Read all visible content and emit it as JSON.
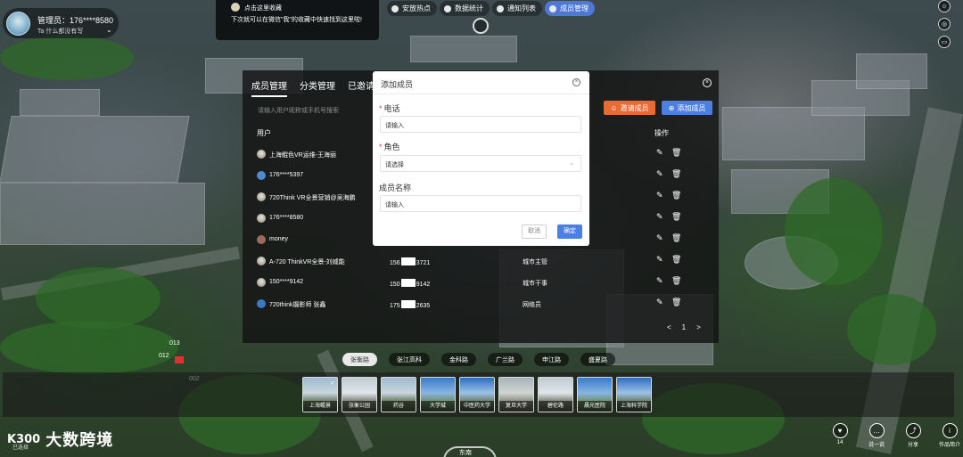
{
  "user": {
    "name": "管理员：176****8580",
    "signature": "Ta 什么都没有写"
  },
  "tip": {
    "title": "点击这里收藏",
    "body": "下次就可以在微信\"我\"的收藏中快速找到这里啦!"
  },
  "topbar": {
    "items": [
      {
        "label": "安放热点",
        "icon": "pin-icon",
        "active": false
      },
      {
        "label": "数据统计",
        "icon": "chart-icon",
        "active": false
      },
      {
        "label": "通知列表",
        "icon": "bell-icon",
        "active": false
      },
      {
        "label": "成员管理",
        "icon": "users-icon",
        "active": true
      }
    ]
  },
  "panel": {
    "tabs": [
      "成员管理",
      "分类管理",
      "已邀请成"
    ],
    "search_placeholder": "请输入用户昵称或手机号搜索",
    "invite_button": "邀请成员",
    "add_button": "添加成员",
    "col_user": "用户",
    "col_ops": "操作",
    "members": [
      {
        "name": "上海鲲色VR运维-王海丽",
        "phone_a": "",
        "phone_b": "",
        "role": ""
      },
      {
        "name": "176****5397",
        "phone_a": "",
        "phone_b": "",
        "role": ""
      },
      {
        "name": "720Think VR全景营销@吴海鹏",
        "phone_a": "",
        "phone_b": "",
        "role": ""
      },
      {
        "name": "176****8580",
        "phone_a": "",
        "phone_b": "",
        "role": ""
      },
      {
        "name": "money",
        "phone_a": "",
        "phone_b": "",
        "role": ""
      },
      {
        "name": "A-720 ThinkVR全景-刘威能",
        "phone_a": "156",
        "phone_b": "3721",
        "role": "城市主管"
      },
      {
        "name": "150****9142",
        "phone_a": "150",
        "phone_b": "9142",
        "role": "城市干事"
      },
      {
        "name": "720think摄影师 张鑫",
        "phone_a": "175",
        "phone_b": "2635",
        "role": "网络员"
      }
    ],
    "pager": {
      "prev": "<",
      "page": "1",
      "next": ">"
    }
  },
  "dialog": {
    "title": "添加成员",
    "phone_label": "电话",
    "phone_placeholder": "请输入",
    "role_label": "角色",
    "role_placeholder": "请选择",
    "member_label": "成员名称",
    "member_placeholder": "请输入",
    "cancel": "取消",
    "ok": "确定"
  },
  "markers": [
    "013",
    "012",
    "002"
  ],
  "categories": [
    {
      "label": "张衡路",
      "active": true
    },
    {
      "label": "张江高科",
      "active": false
    },
    {
      "label": "金科路",
      "active": false
    },
    {
      "label": "广兰路",
      "active": false
    },
    {
      "label": "申江路",
      "active": false
    },
    {
      "label": "盛夏路",
      "active": false
    }
  ],
  "scenes": [
    {
      "label": "上海鲲景",
      "checked": true
    },
    {
      "label": "张衡公园",
      "checked": false
    },
    {
      "label": "药谷",
      "checked": false
    },
    {
      "label": "大学城",
      "checked": false
    },
    {
      "label": "中医药大学",
      "checked": false
    },
    {
      "label": "复旦大学",
      "checked": false
    },
    {
      "label": "碧伦路",
      "checked": false
    },
    {
      "label": "晨光医院",
      "checked": false
    },
    {
      "label": "上海科学院",
      "checked": false
    }
  ],
  "compass_label": "东南",
  "logo": {
    "mark": "K300",
    "text": "大数跨境",
    "sub": "已选择"
  },
  "actions": [
    {
      "label": "14",
      "icon": "heart-icon",
      "glyph": "♥"
    },
    {
      "label": "说一说",
      "icon": "comment-icon",
      "glyph": "…"
    },
    {
      "label": "分享",
      "icon": "share-icon",
      "glyph": "⤴"
    },
    {
      "label": "作品简介",
      "icon": "info-icon",
      "glyph": "i"
    }
  ]
}
